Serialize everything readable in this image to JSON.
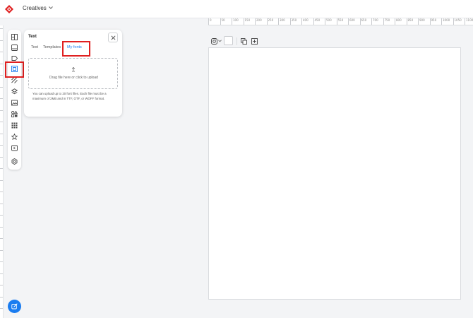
{
  "header": {
    "project_label": "Creatives",
    "brand_color": "#e02020"
  },
  "ruler": {
    "ticks": [
      "0",
      "50",
      "100",
      "150",
      "200",
      "250",
      "300",
      "350",
      "400",
      "450",
      "500",
      "550",
      "600",
      "650",
      "700",
      "750",
      "800",
      "850",
      "900",
      "950",
      "1000",
      "1050",
      "1100"
    ]
  },
  "toolstrip": {
    "tools": [
      {
        "name": "layout",
        "icon": "layout-icon"
      },
      {
        "name": "image",
        "icon": "image-icon"
      },
      {
        "name": "tag",
        "icon": "tag-icon"
      },
      {
        "name": "text",
        "icon": "text-frame-icon",
        "active": true
      },
      {
        "name": "pattern",
        "icon": "stripes-icon"
      },
      {
        "name": "layers",
        "icon": "layers-icon"
      },
      {
        "name": "background",
        "icon": "background-image-icon"
      },
      {
        "name": "elements",
        "icon": "shapes-icon"
      },
      {
        "name": "grid",
        "icon": "grid-icon"
      },
      {
        "name": "favorites",
        "icon": "star-icon"
      },
      {
        "name": "video",
        "icon": "video-icon"
      },
      {
        "name": "settings",
        "icon": "gear-icon"
      }
    ],
    "active_color": "#1a7cf0"
  },
  "panel": {
    "title": "Text",
    "tabs": [
      {
        "label": "Text"
      },
      {
        "label": "Templates"
      },
      {
        "label": "My fonts",
        "active": true
      }
    ],
    "dropzone_label": "Drag file here or click to upload",
    "hint": "You can upload up to 20 font files. Each file must be a maximum of 2MB and in TTF, OTF, or WOFF format."
  },
  "canvas_toolbar": {
    "platform_icon": "instagram-icon",
    "swatch_color": "#ffffff"
  },
  "accent_color": "#1a7cf0"
}
